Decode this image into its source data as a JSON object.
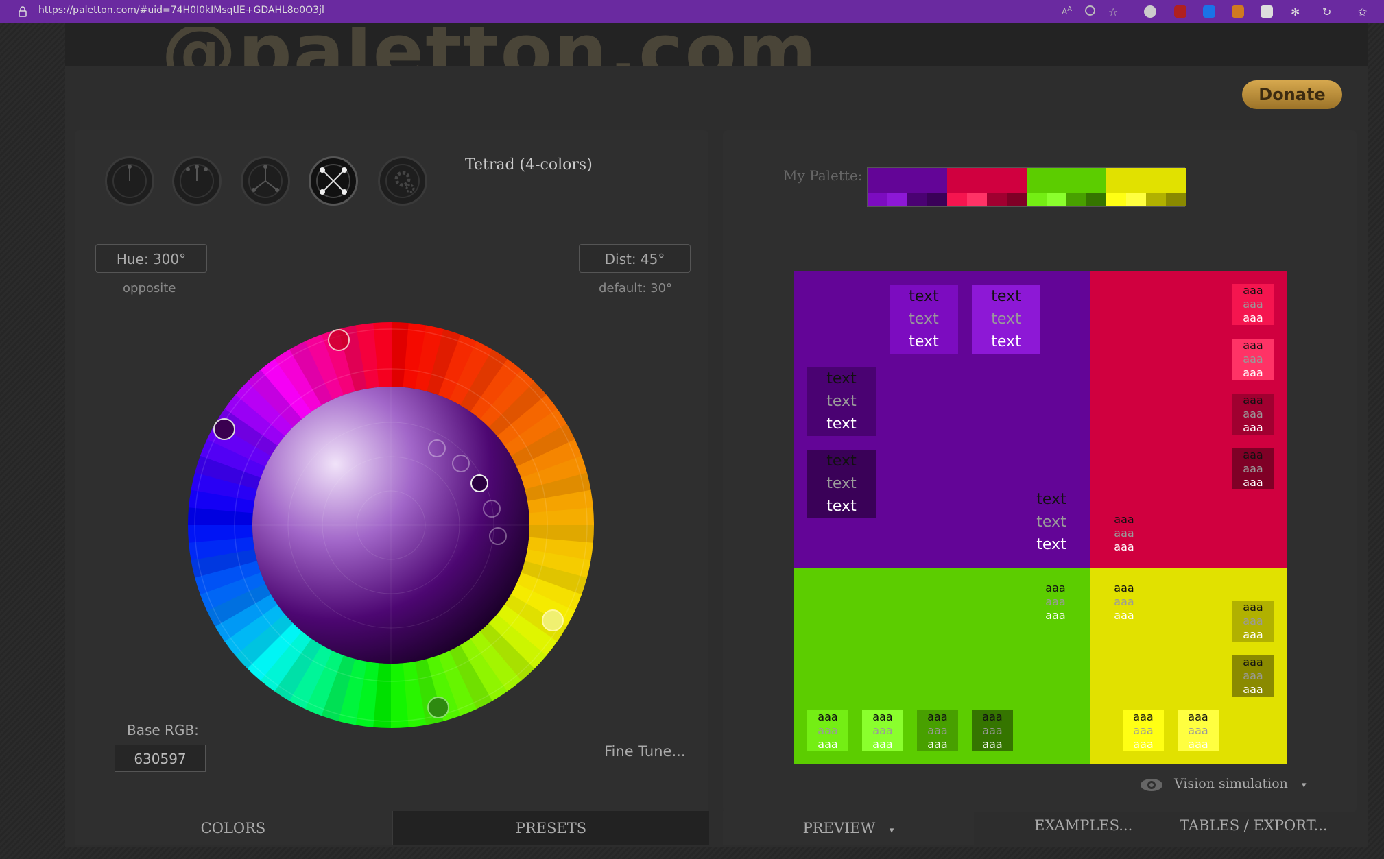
{
  "browser": {
    "url": "https://paletton.com/#uid=74H0I0kIMsqtlE+GDAHL8o0O3jl"
  },
  "donate_label": "Donate",
  "scheme": {
    "title": "Tetrad (4-colors)"
  },
  "hue": {
    "label": "Hue: 300°",
    "sub": "opposite"
  },
  "dist": {
    "label": "Dist: 45°",
    "sub": "default: 30°"
  },
  "base_rgb": {
    "label": "Base RGB:",
    "value": "630597"
  },
  "fine_tune_label": "Fine Tune...",
  "tabs": {
    "colors": "COLORS",
    "presets": "PRESETS",
    "preview": "PREVIEW",
    "preview_arrow": "▾",
    "examples": "EXAMPLES...",
    "tables": "TABLES / EXPORT..."
  },
  "palette": {
    "label": "My Palette:",
    "groups": [
      {
        "main": "#630597",
        "shades": [
          "#7c0cc0",
          "#8d18d6",
          "#4a0272",
          "#3a0158"
        ]
      },
      {
        "main": "#d0003f",
        "shades": [
          "#f5154f",
          "#ff3366",
          "#a00030",
          "#7f0026"
        ]
      },
      {
        "main": "#5ccd00",
        "shades": [
          "#74ee14",
          "#8aff2d",
          "#48a000",
          "#357500"
        ]
      },
      {
        "main": "#e1e100",
        "shades": [
          "#ffff14",
          "#ffff40",
          "#b1b100",
          "#8a8a00"
        ]
      }
    ]
  },
  "preview": {
    "text": "text",
    "aaa": "aaa"
  },
  "vision_label": "Vision simulation",
  "vision_arrow": "▾",
  "colors": {
    "purple": "#630597",
    "red": "#d0003f",
    "green": "#5ccd00",
    "yellow": "#e1e100"
  }
}
